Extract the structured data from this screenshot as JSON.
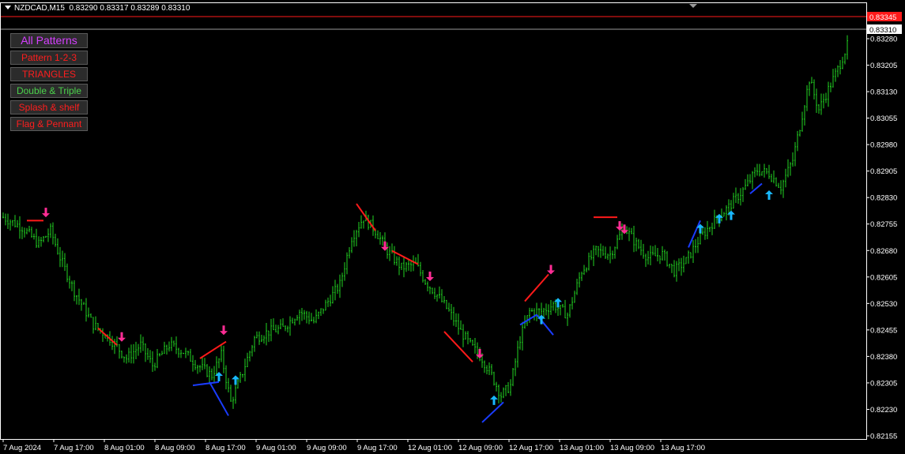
{
  "header": {
    "symbol": "NZDCAD,M15",
    "ohlc": "0.83290 0.83317 0.83289 0.83310"
  },
  "pattern_buttons": [
    {
      "label": "All Patterns",
      "color": "#d53fff"
    },
    {
      "label": "Pattern 1-2-3",
      "color": "#ff1e1e"
    },
    {
      "label": "TRIANGLES",
      "color": "#ff1e1e"
    },
    {
      "label": "Double & Triple",
      "color": "#4bd14b"
    },
    {
      "label": "Splash & shelf",
      "color": "#ff1e1e"
    },
    {
      "label": "Flag & Pennant",
      "color": "#ff1e1e"
    }
  ],
  "colors": {
    "background": "#000000",
    "bars": "#22d422",
    "resistance": "#ff1a1a",
    "support": "#1a3cff",
    "down_arrow": "#ff2d95",
    "up_arrow": "#19b8ff",
    "axis": "#ffffff",
    "price_line": "#ff1a1a"
  },
  "chart_data": {
    "type": "bar",
    "symbol": "NZDCAD",
    "timeframe": "M15",
    "x_tick_labels": [
      "7 Aug 2024",
      "7 Aug 17:00",
      "8 Aug 01:00",
      "8 Aug 09:00",
      "8 Aug 17:00",
      "9 Aug 01:00",
      "9 Aug 09:00",
      "9 Aug 17:00",
      "12 Aug 01:00",
      "12 Aug 09:00",
      "12 Aug 17:00",
      "13 Aug 01:00",
      "13 Aug 09:00",
      "13 Aug 17:00"
    ],
    "y_tick_labels": [
      "0.83280",
      "0.83205",
      "0.83130",
      "0.83055",
      "0.82980",
      "0.82905",
      "0.82830",
      "0.82755",
      "0.82680",
      "0.82605",
      "0.82530",
      "0.82455",
      "0.82380",
      "0.82305",
      "0.82230",
      "0.82155"
    ],
    "ylim": [
      0.8215,
      0.8338
    ],
    "current_price_label": "0.83310",
    "red_line_price_label": "0.83345",
    "price_path": [
      {
        "i": 0,
        "p": 0.828
      },
      {
        "i": 8,
        "p": 0.8277
      },
      {
        "i": 15,
        "p": 0.8272
      },
      {
        "i": 20,
        "p": 0.8276
      },
      {
        "i": 24,
        "p": 0.8268
      },
      {
        "i": 30,
        "p": 0.8258
      },
      {
        "i": 38,
        "p": 0.8248
      },
      {
        "i": 45,
        "p": 0.8244
      },
      {
        "i": 52,
        "p": 0.8238
      },
      {
        "i": 58,
        "p": 0.8242
      },
      {
        "i": 63,
        "p": 0.8236
      },
      {
        "i": 70,
        "p": 0.8242
      },
      {
        "i": 76,
        "p": 0.824
      },
      {
        "i": 82,
        "p": 0.8236
      },
      {
        "i": 88,
        "p": 0.8233
      },
      {
        "i": 92,
        "p": 0.8239
      },
      {
        "i": 96,
        "p": 0.8225
      },
      {
        "i": 100,
        "p": 0.8232
      },
      {
        "i": 106,
        "p": 0.8244
      },
      {
        "i": 112,
        "p": 0.8246
      },
      {
        "i": 118,
        "p": 0.8247
      },
      {
        "i": 125,
        "p": 0.8252
      },
      {
        "i": 131,
        "p": 0.8249
      },
      {
        "i": 137,
        "p": 0.8255
      },
      {
        "i": 142,
        "p": 0.826
      },
      {
        "i": 147,
        "p": 0.8274
      },
      {
        "i": 152,
        "p": 0.828
      },
      {
        "i": 157,
        "p": 0.8276
      },
      {
        "i": 162,
        "p": 0.827
      },
      {
        "i": 168,
        "p": 0.8265
      },
      {
        "i": 174,
        "p": 0.8266
      },
      {
        "i": 178,
        "p": 0.8261
      },
      {
        "i": 184,
        "p": 0.8256
      },
      {
        "i": 188,
        "p": 0.8252
      },
      {
        "i": 193,
        "p": 0.8246
      },
      {
        "i": 197,
        "p": 0.8242
      },
      {
        "i": 202,
        "p": 0.8238
      },
      {
        "i": 206,
        "p": 0.8233
      },
      {
        "i": 210,
        "p": 0.8227
      },
      {
        "i": 214,
        "p": 0.823
      },
      {
        "i": 218,
        "p": 0.8244
      },
      {
        "i": 222,
        "p": 0.8252
      },
      {
        "i": 227,
        "p": 0.8252
      },
      {
        "i": 232,
        "p": 0.8254
      },
      {
        "i": 238,
        "p": 0.8251
      },
      {
        "i": 244,
        "p": 0.8264
      },
      {
        "i": 250,
        "p": 0.827
      },
      {
        "i": 256,
        "p": 0.8269
      },
      {
        "i": 262,
        "p": 0.8277
      },
      {
        "i": 267,
        "p": 0.8272
      },
      {
        "i": 272,
        "p": 0.8268
      },
      {
        "i": 278,
        "p": 0.8269
      },
      {
        "i": 283,
        "p": 0.8264
      },
      {
        "i": 288,
        "p": 0.8267
      },
      {
        "i": 294,
        "p": 0.8274
      },
      {
        "i": 300,
        "p": 0.8279
      },
      {
        "i": 306,
        "p": 0.8283
      },
      {
        "i": 312,
        "p": 0.8288
      },
      {
        "i": 318,
        "p": 0.8294
      },
      {
        "i": 323,
        "p": 0.8293
      },
      {
        "i": 328,
        "p": 0.8289
      },
      {
        "i": 333,
        "p": 0.8297
      },
      {
        "i": 336,
        "p": 0.8307
      },
      {
        "i": 340,
        "p": 0.8321
      },
      {
        "i": 344,
        "p": 0.8312
      },
      {
        "i": 348,
        "p": 0.8318
      },
      {
        "i": 352,
        "p": 0.8324
      },
      {
        "i": 356,
        "p": 0.8331
      }
    ],
    "pattern_lines": [
      {
        "color": "resistance",
        "from": {
          "i": 10,
          "p": 0.8279
        },
        "to": {
          "i": 17,
          "p": 0.8279
        }
      },
      {
        "color": "resistance",
        "from": {
          "i": 40,
          "p": 0.8247
        },
        "to": {
          "i": 48,
          "p": 0.8242
        }
      },
      {
        "color": "resistance",
        "from": {
          "i": 83,
          "p": 0.8238
        },
        "to": {
          "i": 94,
          "p": 0.8243
        }
      },
      {
        "color": "support",
        "from": {
          "i": 80,
          "p": 0.823
        },
        "to": {
          "i": 91,
          "p": 0.8231
        }
      },
      {
        "color": "support",
        "from": {
          "i": 87,
          "p": 0.8231
        },
        "to": {
          "i": 95,
          "p": 0.8221
        }
      },
      {
        "color": "resistance",
        "from": {
          "i": 149,
          "p": 0.8284
        },
        "to": {
          "i": 157,
          "p": 0.8276
        }
      },
      {
        "color": "resistance",
        "from": {
          "i": 164,
          "p": 0.827
        },
        "to": {
          "i": 175,
          "p": 0.8266
        }
      },
      {
        "color": "resistance",
        "from": {
          "i": 186,
          "p": 0.8246
        },
        "to": {
          "i": 198,
          "p": 0.8237
        }
      },
      {
        "color": "support",
        "from": {
          "i": 202,
          "p": 0.8219
        },
        "to": {
          "i": 211,
          "p": 0.8225
        }
      },
      {
        "color": "resistance",
        "from": {
          "i": 220,
          "p": 0.8255
        },
        "to": {
          "i": 230,
          "p": 0.8263
        }
      },
      {
        "color": "support",
        "from": {
          "i": 218,
          "p": 0.8248
        },
        "to": {
          "i": 225,
          "p": 0.8251
        }
      },
      {
        "color": "support",
        "from": {
          "i": 225,
          "p": 0.8251
        },
        "to": {
          "i": 232,
          "p": 0.8245
        }
      },
      {
        "color": "resistance",
        "from": {
          "i": 249,
          "p": 0.828
        },
        "to": {
          "i": 259,
          "p": 0.828
        }
      },
      {
        "color": "support",
        "from": {
          "i": 289,
          "p": 0.8271
        },
        "to": {
          "i": 294,
          "p": 0.8279
        }
      },
      {
        "color": "support",
        "from": {
          "i": 315,
          "p": 0.8287
        },
        "to": {
          "i": 320,
          "p": 0.829
        }
      }
    ],
    "arrows": [
      {
        "dir": "down",
        "i": 18,
        "p": 0.828
      },
      {
        "dir": "down",
        "i": 50,
        "p": 0.8243
      },
      {
        "dir": "down",
        "i": 93,
        "p": 0.8245
      },
      {
        "dir": "up",
        "i": 91,
        "p": 0.8234
      },
      {
        "dir": "up",
        "i": 98,
        "p": 0.8233
      },
      {
        "dir": "down",
        "i": 161,
        "p": 0.827
      },
      {
        "dir": "down",
        "i": 180,
        "p": 0.8261
      },
      {
        "dir": "down",
        "i": 201,
        "p": 0.8238
      },
      {
        "dir": "up",
        "i": 207,
        "p": 0.8227
      },
      {
        "dir": "up",
        "i": 227,
        "p": 0.8251
      },
      {
        "dir": "down",
        "i": 231,
        "p": 0.8263
      },
      {
        "dir": "up",
        "i": 234,
        "p": 0.8256
      },
      {
        "dir": "down",
        "i": 260,
        "p": 0.8276
      },
      {
        "dir": "down",
        "i": 262,
        "p": 0.8275
      },
      {
        "dir": "up",
        "i": 294,
        "p": 0.8278
      },
      {
        "dir": "up",
        "i": 302,
        "p": 0.8281
      },
      {
        "dir": "up",
        "i": 307,
        "p": 0.8282
      },
      {
        "dir": "up",
        "i": 323,
        "p": 0.8288
      }
    ]
  }
}
